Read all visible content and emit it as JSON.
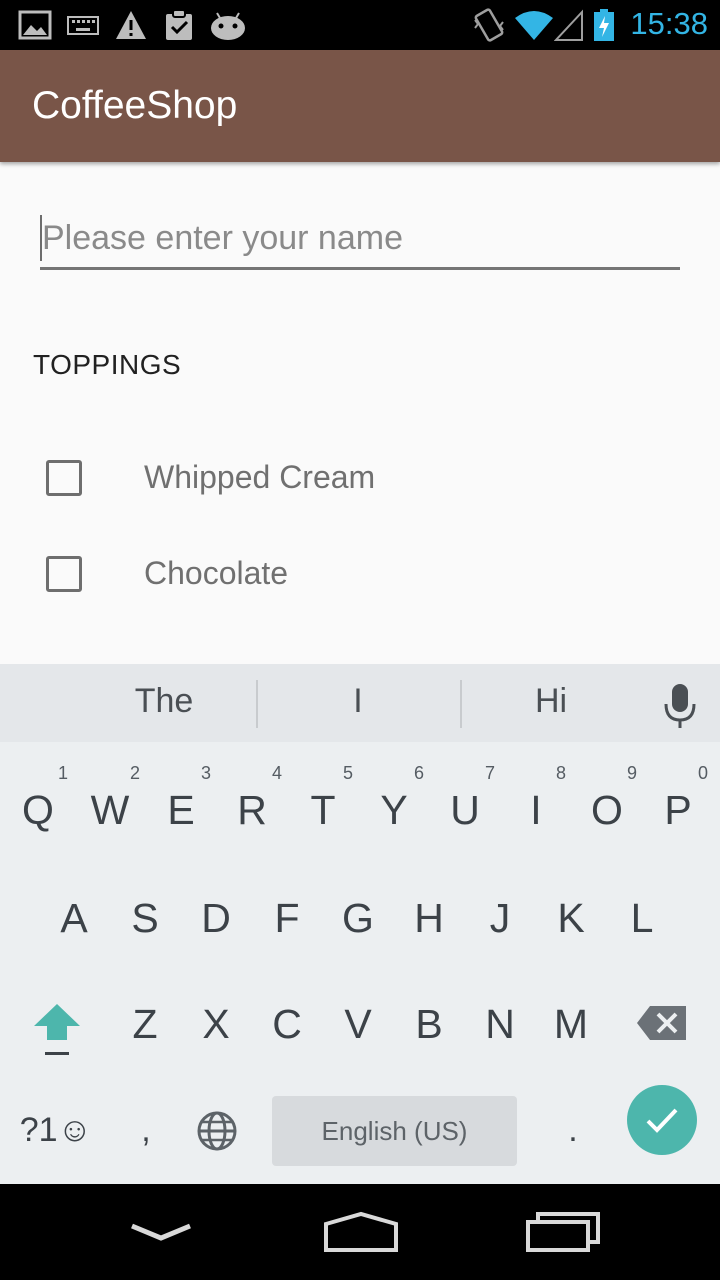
{
  "status_bar": {
    "time": "15:38",
    "icons": [
      "image-icon",
      "keyboard-icon",
      "warning-icon",
      "clipboard-check-icon",
      "android-icon",
      "vibrate-icon",
      "wifi-icon",
      "signal-icon",
      "battery-charging-icon"
    ]
  },
  "app_bar": {
    "title": "CoffeeShop"
  },
  "form": {
    "name_placeholder": "Please enter your name",
    "name_value": "",
    "section_label": "TOPPINGS",
    "toppings": [
      {
        "label": "Whipped Cream",
        "checked": false
      },
      {
        "label": "Chocolate",
        "checked": false
      }
    ]
  },
  "keyboard": {
    "suggestions": [
      "The",
      "I",
      "Hi"
    ],
    "row1": [
      {
        "key": "Q",
        "hint": "1"
      },
      {
        "key": "W",
        "hint": "2"
      },
      {
        "key": "E",
        "hint": "3"
      },
      {
        "key": "R",
        "hint": "4"
      },
      {
        "key": "T",
        "hint": "5"
      },
      {
        "key": "Y",
        "hint": "6"
      },
      {
        "key": "U",
        "hint": "7"
      },
      {
        "key": "I",
        "hint": "8"
      },
      {
        "key": "O",
        "hint": "9"
      },
      {
        "key": "P",
        "hint": "0"
      }
    ],
    "row2": [
      "A",
      "S",
      "D",
      "F",
      "G",
      "H",
      "J",
      "K",
      "L"
    ],
    "row3": [
      "Z",
      "X",
      "C",
      "V",
      "B",
      "N",
      "M"
    ],
    "symbols_label": "?1☺",
    "comma": ",",
    "period": ".",
    "space_label": "English (US)",
    "accent_color": "#4db6ac"
  },
  "nav_bar": {
    "buttons": [
      "back-icon",
      "home-icon",
      "recents-icon"
    ]
  },
  "colors": {
    "app_bar": "#795548",
    "status_time": "#33b5e5"
  }
}
